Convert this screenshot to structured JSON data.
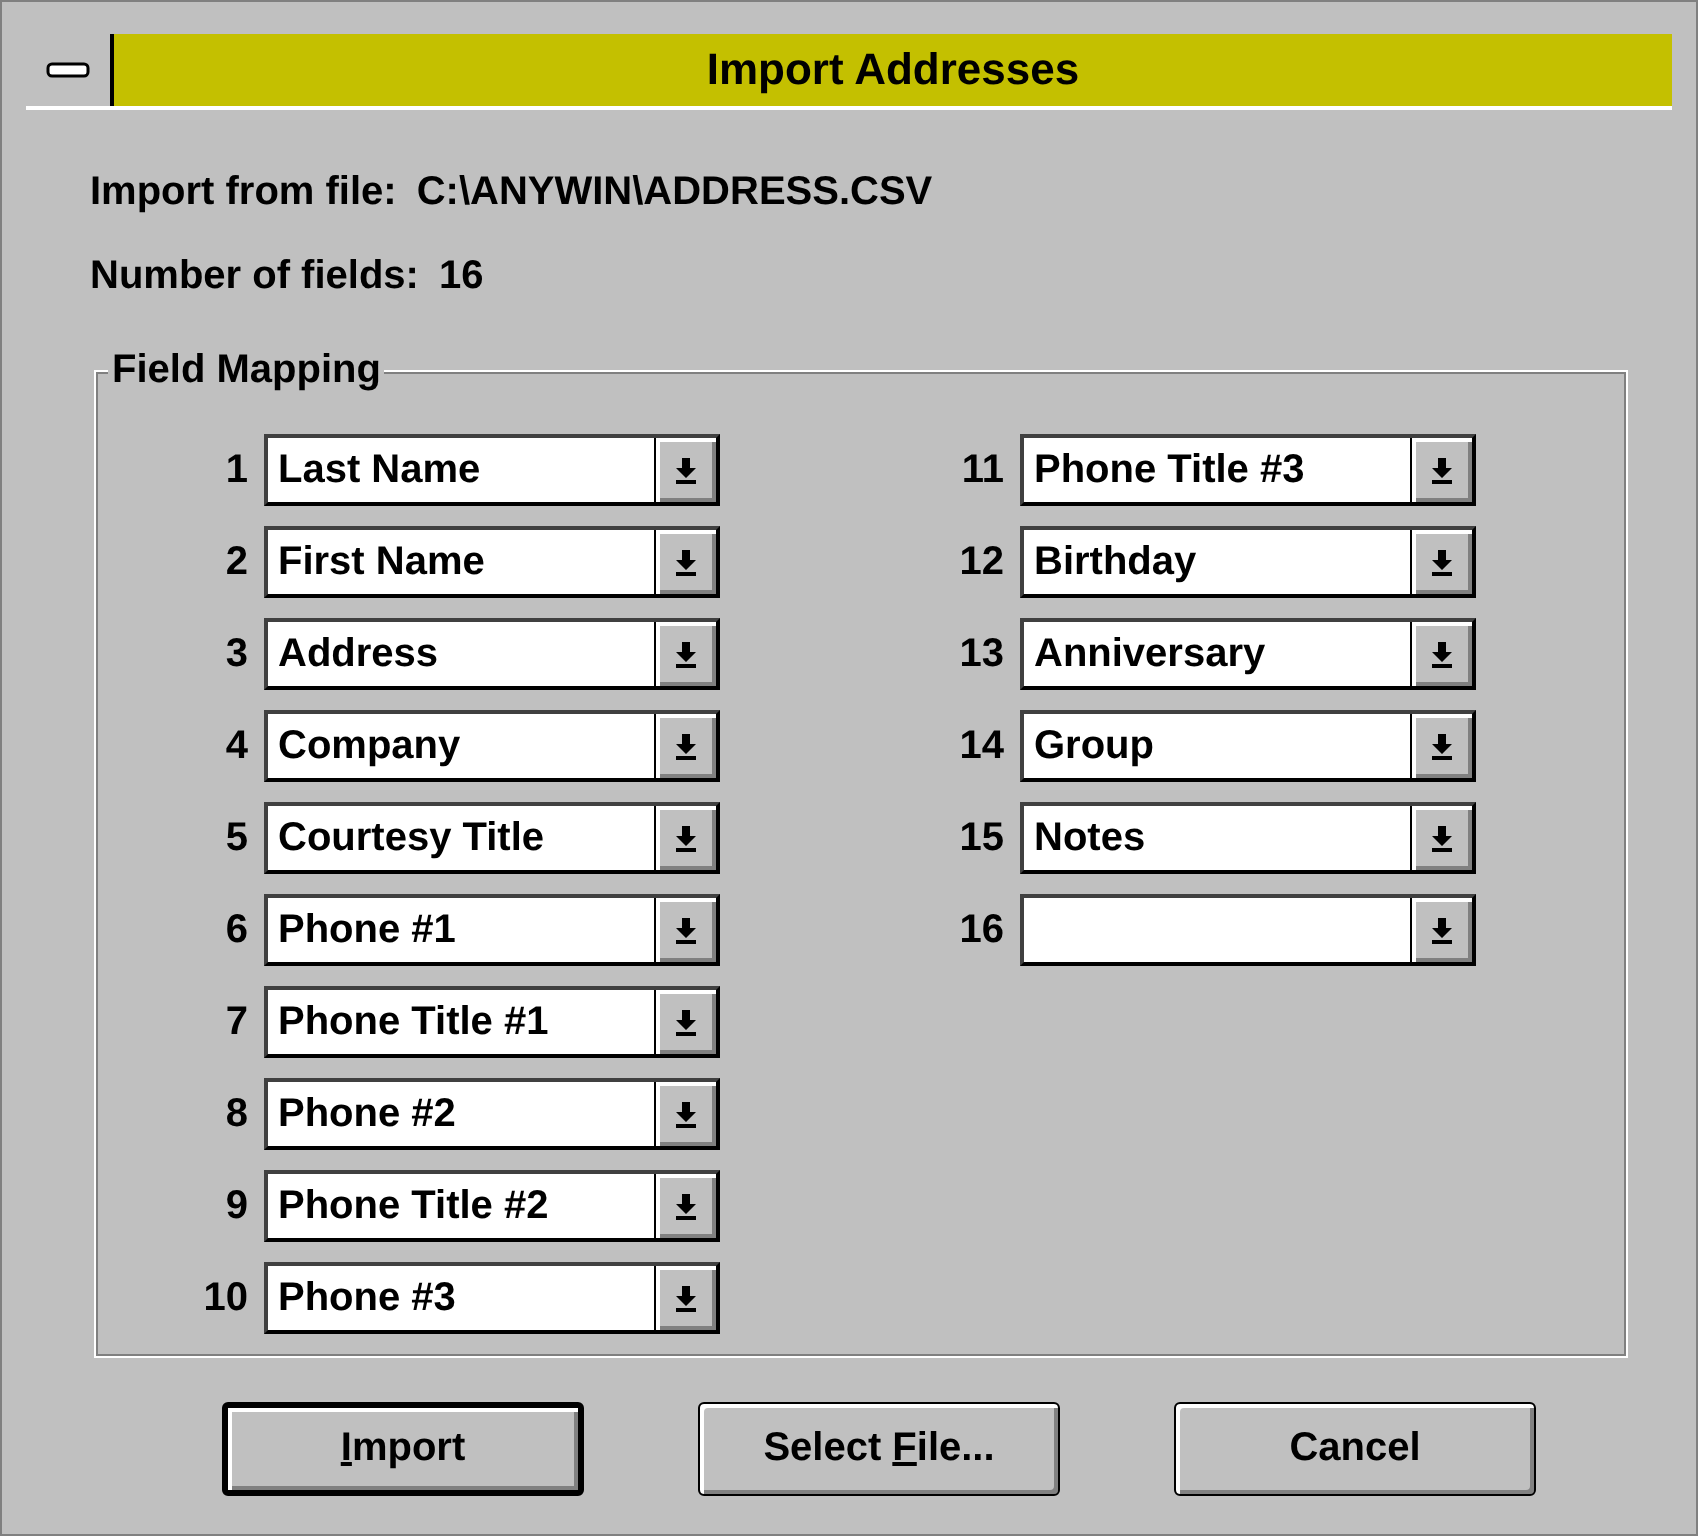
{
  "window": {
    "title": "Import Addresses"
  },
  "import_from_file": {
    "label": "Import from file:",
    "value": "C:\\ANYWIN\\ADDRESS.CSV"
  },
  "number_of_fields": {
    "label": "Number of fields:",
    "value": "16"
  },
  "field_mapping": {
    "title": "Field Mapping",
    "fields": [
      {
        "number": "1",
        "value": "Last Name"
      },
      {
        "number": "2",
        "value": "First Name"
      },
      {
        "number": "3",
        "value": "Address"
      },
      {
        "number": "4",
        "value": "Company"
      },
      {
        "number": "5",
        "value": "Courtesy Title"
      },
      {
        "number": "6",
        "value": "Phone #1"
      },
      {
        "number": "7",
        "value": "Phone Title #1"
      },
      {
        "number": "8",
        "value": "Phone #2"
      },
      {
        "number": "9",
        "value": "Phone Title #2"
      },
      {
        "number": "10",
        "value": "Phone #3"
      },
      {
        "number": "11",
        "value": "Phone Title #3"
      },
      {
        "number": "12",
        "value": "Birthday"
      },
      {
        "number": "13",
        "value": "Anniversary"
      },
      {
        "number": "14",
        "value": "Group"
      },
      {
        "number": "15",
        "value": "Notes"
      },
      {
        "number": "16"
      }
    ]
  },
  "buttons": [
    {
      "access_key": "I",
      "label_after": "mport",
      "default": true
    },
    {
      "label_before": "Select ",
      "access_key": "F",
      "label_after": "ile...",
      "default": false
    },
    {
      "label_after": "Cancel",
      "default": false
    }
  ]
}
